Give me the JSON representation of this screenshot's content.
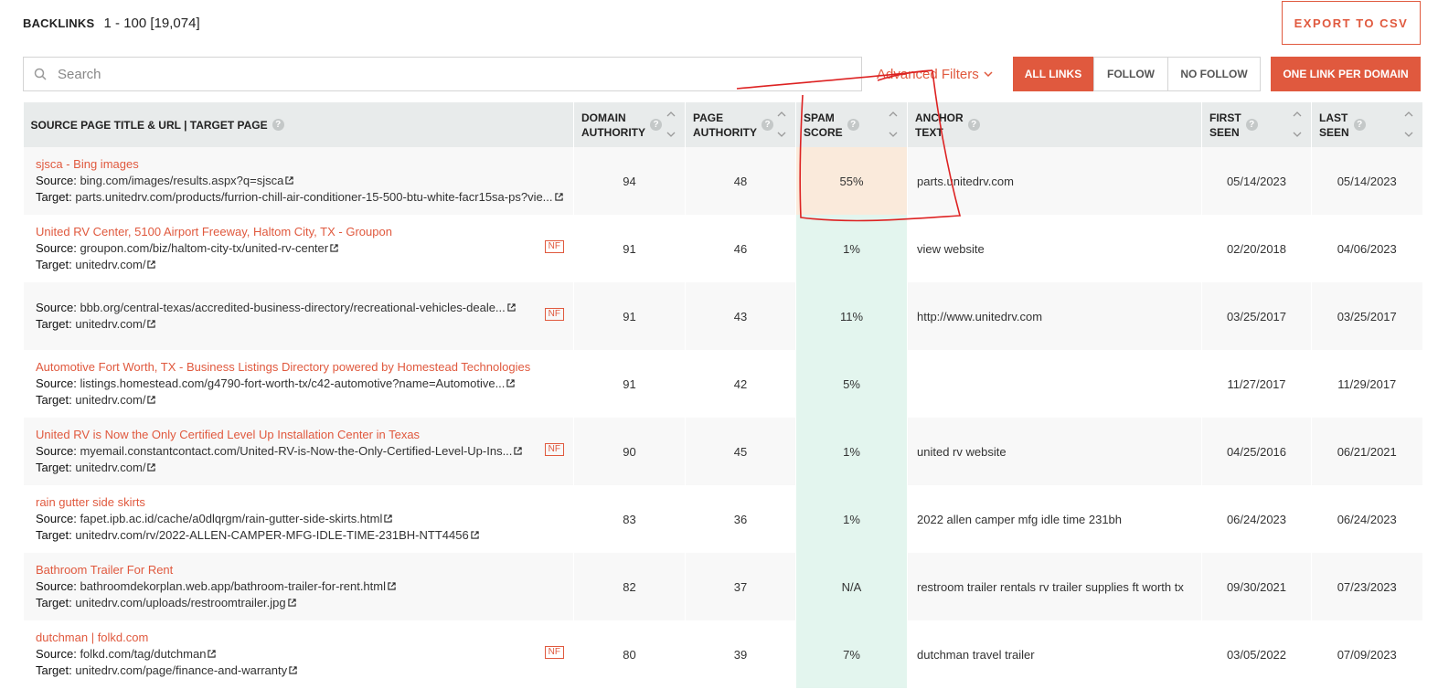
{
  "header": {
    "title": "BACKLINKS",
    "range": "1 - 100 [19,074]",
    "export_label": "EXPORT TO CSV"
  },
  "search": {
    "placeholder": "Search",
    "value": ""
  },
  "advanced_filters_label": "Advanced Filters",
  "link_filter": {
    "options": [
      "ALL LINKS",
      "FOLLOW",
      "NO FOLLOW"
    ],
    "selected": "ALL LINKS"
  },
  "one_link_label": "ONE LINK PER DOMAIN",
  "columns": {
    "source": "SOURCE PAGE TITLE & URL | TARGET PAGE",
    "da": [
      "DOMAIN",
      "AUTHORITY"
    ],
    "pa": [
      "PAGE",
      "AUTHORITY"
    ],
    "spam": [
      "SPAM",
      "SCORE"
    ],
    "anchor": [
      "ANCHOR",
      "TEXT"
    ],
    "first": [
      "FIRST",
      "SEEN"
    ],
    "last": [
      "LAST",
      "SEEN"
    ]
  },
  "labels": {
    "source": "Source:",
    "target": "Target:",
    "nf": "NF"
  },
  "rows": [
    {
      "title": "sjsca - Bing images",
      "source": "bing.com/images/results.aspx?q=sjsca",
      "target": "parts.unitedrv.com/products/furrion-chill-air-conditioner-15-500-btu-white-facr15sa-ps?vie...",
      "nf": false,
      "da": "94",
      "pa": "48",
      "spam": "55%",
      "anchor": "parts.unitedrv.com",
      "first": "05/14/2023",
      "last": "05/14/2023"
    },
    {
      "title": "United RV Center, 5100 Airport Freeway, Haltom City, TX - Groupon",
      "source": "groupon.com/biz/haltom-city-tx/united-rv-center",
      "target": "unitedrv.com/",
      "nf": true,
      "da": "91",
      "pa": "46",
      "spam": "1%",
      "anchor": "view website",
      "first": "02/20/2018",
      "last": "04/06/2023"
    },
    {
      "title": "",
      "source": "bbb.org/central-texas/accredited-business-directory/recreational-vehicles-deale...",
      "target": "unitedrv.com/",
      "nf": true,
      "da": "91",
      "pa": "43",
      "spam": "11%",
      "anchor": "http://www.unitedrv.com",
      "first": "03/25/2017",
      "last": "03/25/2017"
    },
    {
      "title": "Automotive Fort Worth, TX - Business Listings Directory powered by Homestead Technologies",
      "source": "listings.homestead.com/g4790-fort-worth-tx/c42-automotive?name=Automotive...",
      "target": "unitedrv.com/",
      "nf": false,
      "da": "91",
      "pa": "42",
      "spam": "5%",
      "anchor": "",
      "first": "11/27/2017",
      "last": "11/29/2017"
    },
    {
      "title": "United RV is Now the Only Certified Level Up Installation Center in Texas",
      "source": "myemail.constantcontact.com/United-RV-is-Now-the-Only-Certified-Level-Up-Ins...",
      "target": "unitedrv.com/",
      "nf": true,
      "da": "90",
      "pa": "45",
      "spam": "1%",
      "anchor": "united rv website",
      "first": "04/25/2016",
      "last": "06/21/2021"
    },
    {
      "title": "rain gutter side skirts",
      "source": "fapet.ipb.ac.id/cache/a0dlqrgm/rain-gutter-side-skirts.html",
      "target": "unitedrv.com/rv/2022-ALLEN-CAMPER-MFG-IDLE-TIME-231BH-NTT4456",
      "nf": false,
      "da": "83",
      "pa": "36",
      "spam": "1%",
      "anchor": "2022 allen camper mfg idle time 231bh",
      "first": "06/24/2023",
      "last": "06/24/2023"
    },
    {
      "title": "Bathroom Trailer For Rent",
      "source": "bathroomdekorplan.web.app/bathroom-trailer-for-rent.html",
      "target": "unitedrv.com/uploads/restroomtrailer.jpg",
      "nf": false,
      "da": "82",
      "pa": "37",
      "spam": "N/A",
      "anchor": "restroom trailer rentals rv trailer supplies ft worth tx",
      "first": "09/30/2021",
      "last": "07/23/2023"
    },
    {
      "title": "dutchman | folkd.com",
      "source": "folkd.com/tag/dutchman",
      "target": "unitedrv.com/page/finance-and-warranty",
      "nf": true,
      "da": "80",
      "pa": "39",
      "spam": "7%",
      "anchor": "dutchman travel trailer",
      "first": "03/05/2022",
      "last": "07/09/2023"
    }
  ],
  "colors": {
    "accent": "#e0593e",
    "spam_low": "#e3f5ee",
    "spam_high": "#faeadb",
    "annotation": "#d22"
  }
}
